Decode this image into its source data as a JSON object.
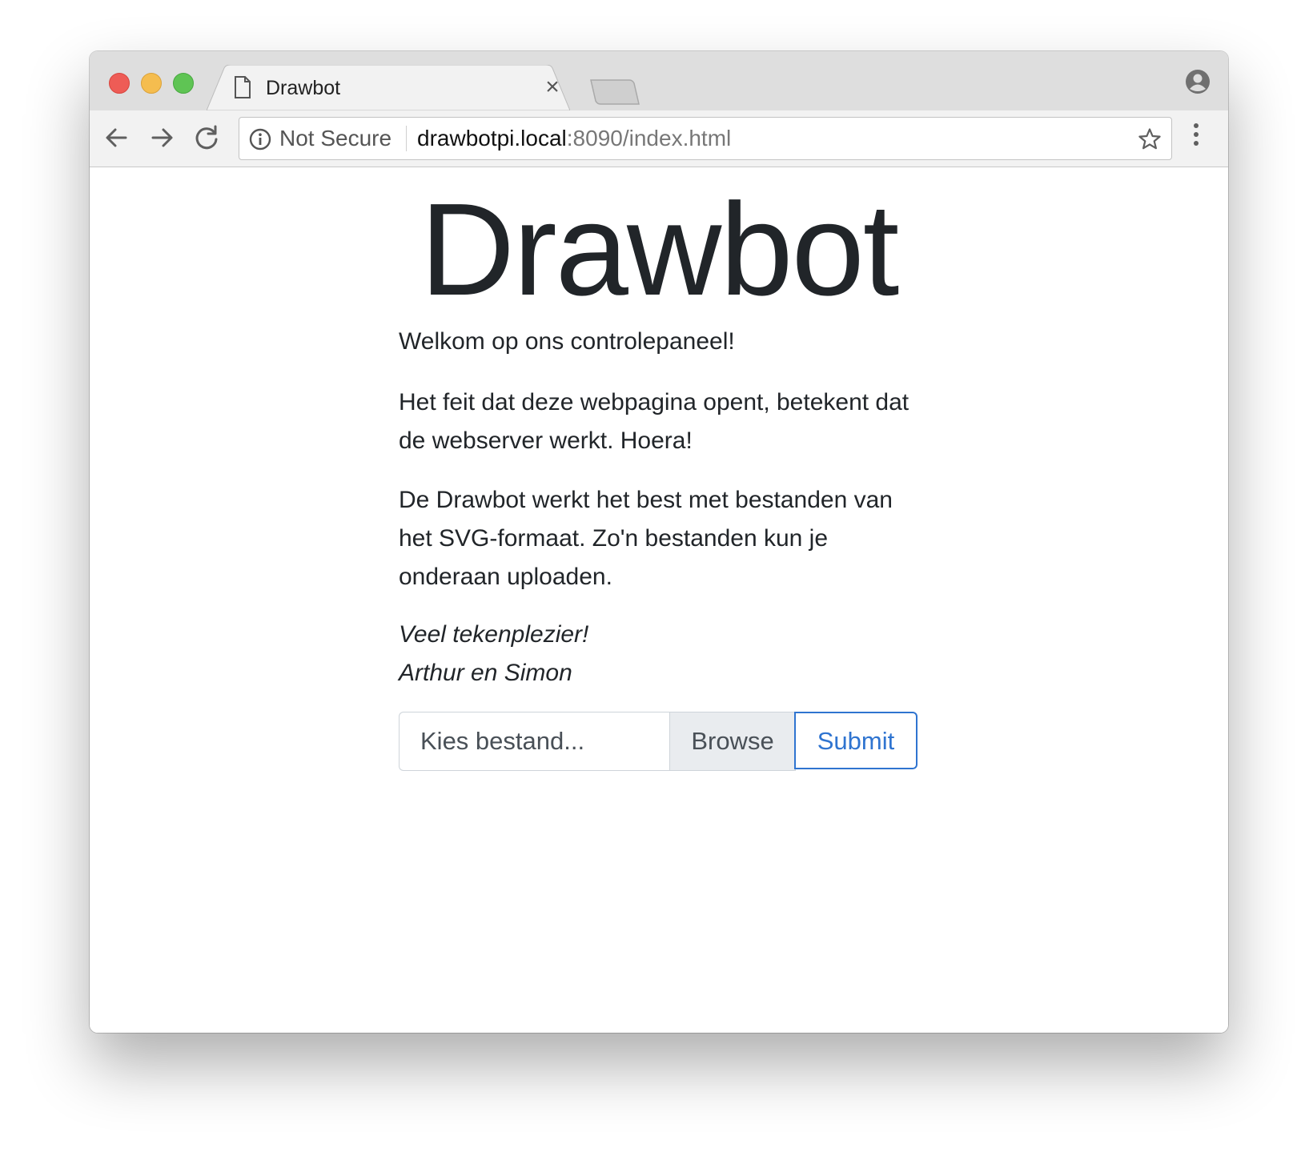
{
  "browser": {
    "tab": {
      "title": "Drawbot",
      "close_symbol": "×"
    },
    "omnibox": {
      "security_label": "Not Secure",
      "url_host": "drawbotpi.local",
      "url_rest": ":8090/index.html"
    },
    "icons": [
      "page-icon",
      "close-icon",
      "new-tab-icon",
      "profile-icon",
      "back-icon",
      "forward-icon",
      "reload-icon",
      "info-icon",
      "star-icon",
      "menu-icon"
    ]
  },
  "page": {
    "title": "Drawbot",
    "paragraphs": [
      "Welkom op ons controlepaneel!",
      "Het feit dat deze webpagina opent, betekent dat de webserver werkt. Hoera!",
      "De Drawbot werkt het best met bestanden van het SVG-formaat. Zo'n bestanden kun je onderaan uploaden."
    ],
    "signoff": {
      "line1": "Veel tekenplezier!",
      "line2": "Arthur en Simon"
    },
    "upload": {
      "placeholder": "Kies bestand...",
      "browse_label": "Browse",
      "submit_label": "Submit"
    }
  },
  "colors": {
    "text": "#212529",
    "accent": "#2f74d0",
    "traffic_close": "#ee5c56",
    "traffic_minimize": "#f5bd4f",
    "traffic_maximize": "#5fc454"
  }
}
